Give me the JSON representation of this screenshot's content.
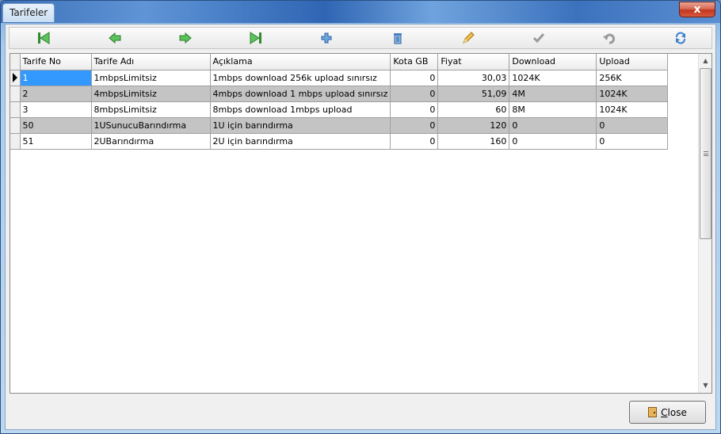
{
  "window": {
    "title": "Tarifeler",
    "close_glyph": "x"
  },
  "toolbar": [
    {
      "name": "first-record-button",
      "icon": "first-green-arrow-icon"
    },
    {
      "name": "prior-record-button",
      "icon": "left-green-arrow-icon"
    },
    {
      "name": "next-record-button",
      "icon": "right-green-arrow-icon"
    },
    {
      "name": "last-record-button",
      "icon": "last-green-arrow-icon"
    },
    {
      "name": "insert-record-button",
      "icon": "plus-icon"
    },
    {
      "name": "delete-record-button",
      "icon": "trash-icon"
    },
    {
      "name": "edit-record-button",
      "icon": "pencil-icon"
    },
    {
      "name": "post-record-button",
      "icon": "checkmark-icon"
    },
    {
      "name": "cancel-edit-button",
      "icon": "undo-icon"
    },
    {
      "name": "refresh-button",
      "icon": "refresh-icon"
    }
  ],
  "grid": {
    "columns": [
      "Tarife No",
      "Tarife Adı",
      "Açıklama",
      "Kota GB",
      "Fiyat",
      "Download",
      "Upload"
    ],
    "rows": [
      [
        "1",
        "1mbpsLimitsiz",
        "1mbps download 256k upload sınırsız",
        "0",
        "30,03",
        "1024K",
        "256K"
      ],
      [
        "2",
        "4mbpsLimitsiz",
        "4mbps download 1 mbps upload sınırsız",
        "0",
        "51,09",
        "4M",
        "1024K"
      ],
      [
        "3",
        "8mbpsLimitsiz",
        "8mbps download 1mbps upload",
        "0",
        "60",
        "8M",
        "1024K"
      ],
      [
        "50",
        "1USunucuBarındırma",
        "1U için barındırma",
        "0",
        "120",
        "0",
        "0"
      ],
      [
        "51",
        "2UBarındırma",
        "2U için barındırma",
        "0",
        "160",
        "0",
        "0"
      ]
    ],
    "selected_row": 0
  },
  "footer": {
    "close_label": "Close"
  },
  "colors": {
    "selection": "#3399ff",
    "alt_row": "#c4c4c4",
    "title_tab": "#c9def3"
  }
}
